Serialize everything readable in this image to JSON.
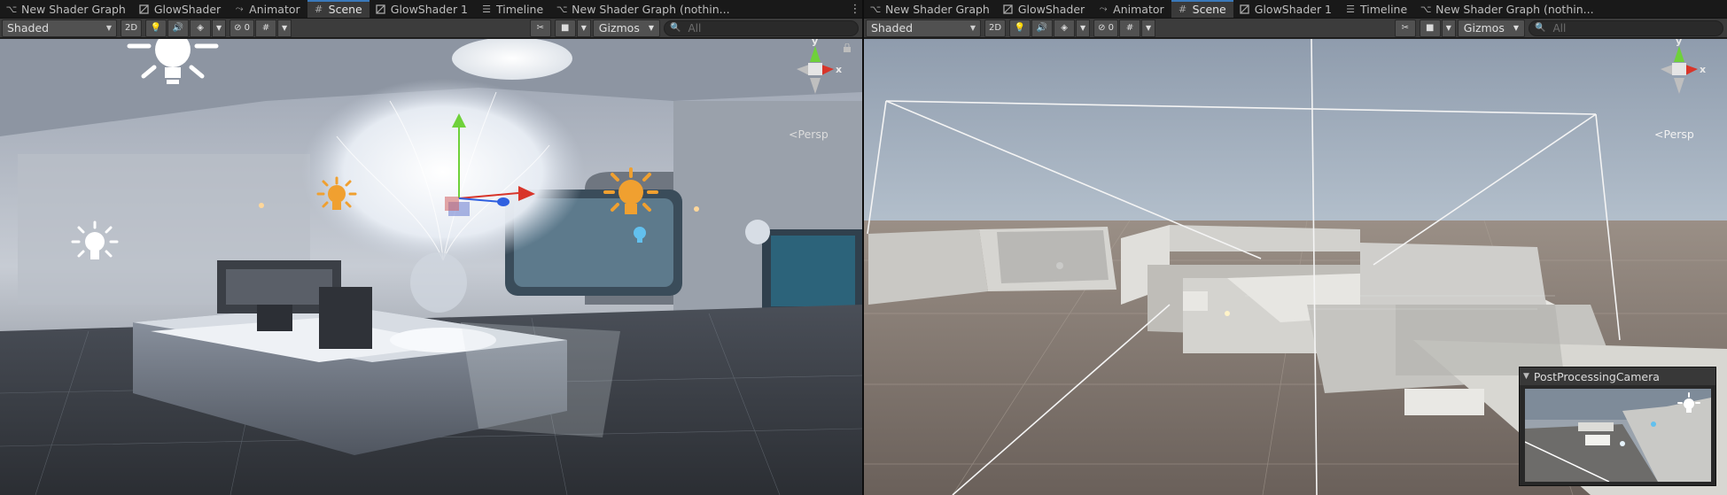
{
  "left_pane": {
    "tabs": [
      {
        "label": "New Shader Graph",
        "icon": "shader-graph-icon"
      },
      {
        "label": "GlowShader",
        "icon": "shader-icon"
      },
      {
        "label": "Animator",
        "icon": "animator-icon"
      },
      {
        "label": "Scene",
        "icon": "scene-hash-icon",
        "active": true
      },
      {
        "label": "GlowShader 1",
        "icon": "shader-icon"
      },
      {
        "label": "Timeline",
        "icon": "timeline-icon"
      },
      {
        "label": "New Shader Graph (nothin...",
        "icon": "shader-graph-icon"
      }
    ],
    "toolbar": {
      "shading_mode": "Shaded",
      "mode_2d": "2D",
      "hidden_count": "0",
      "gizmos_label": "Gizmos",
      "search_placeholder": "All"
    },
    "persp_label": "<Persp",
    "axis_y": "y",
    "axis_x": "x"
  },
  "right_pane": {
    "tabs": [
      {
        "label": "New Shader Graph",
        "icon": "shader-graph-icon"
      },
      {
        "label": "GlowShader",
        "icon": "shader-icon"
      },
      {
        "label": "Animator",
        "icon": "animator-icon"
      },
      {
        "label": "Scene",
        "icon": "scene-hash-icon",
        "active": true
      },
      {
        "label": "GlowShader 1",
        "icon": "shader-icon"
      },
      {
        "label": "Timeline",
        "icon": "timeline-icon"
      },
      {
        "label": "New Shader Graph (nothin...",
        "icon": "shader-graph-icon"
      }
    ],
    "toolbar": {
      "shading_mode": "Shaded",
      "mode_2d": "2D",
      "hidden_count": "0",
      "gizmos_label": "Gizmos",
      "search_placeholder": "All"
    },
    "persp_label": "<Persp",
    "axis_y": "y",
    "axis_x": "x",
    "camera_preview_title": "PostProcessingCamera"
  },
  "colors": {
    "tab_accent": "#3a79bb",
    "axis_y": "#6fd13a",
    "axis_x": "#d8352a",
    "axis_z": "#2f60e0",
    "light_gizmo_orange": "#f0a030"
  }
}
